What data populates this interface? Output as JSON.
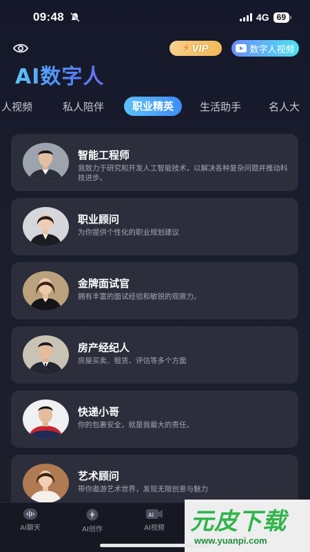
{
  "status": {
    "time": "09:48",
    "network": "4G",
    "battery": "69"
  },
  "header": {
    "vip_label": "VIP",
    "video_label": "数字人视频",
    "title": "AI数字人"
  },
  "tabs": [
    {
      "label": "人视频"
    },
    {
      "label": "私人陪伴"
    },
    {
      "label": "职业精英",
      "active": true
    },
    {
      "label": "生活助手"
    },
    {
      "label": "名人大"
    }
  ],
  "cards": [
    {
      "title": "智能工程师",
      "desc": "我致力于研究和开发人工智能技术，以解决各种复杂问题并推动科技进步。",
      "avatar": "engineer-avatar"
    },
    {
      "title": "职业顾问",
      "desc": "为你提供个性化的职业规划建议",
      "avatar": "consultant-avatar"
    },
    {
      "title": "金牌面试官",
      "desc": "拥有丰富的面试经验和敏锐的观察力。",
      "avatar": "interviewer-avatar"
    },
    {
      "title": "房产经纪人",
      "desc": "房屋买卖、租赁、评估等多个方面",
      "avatar": "realtor-avatar"
    },
    {
      "title": "快递小哥",
      "desc": "你的包裹安全，就是我最大的责任。",
      "avatar": "courier-avatar"
    },
    {
      "title": "艺术顾问",
      "desc": "带你遨游艺术世界，发现无限创意与魅力",
      "avatar": "art-advisor-avatar"
    }
  ],
  "bottom_nav": [
    {
      "label": "AI聊天",
      "icon": "wave-icon"
    },
    {
      "label": "AI创作",
      "icon": "bolt-icon"
    },
    {
      "label": "AI视频",
      "icon": "ai-video-icon"
    }
  ],
  "watermark": {
    "text": "元皮下载",
    "url": "www.yuanpi.com"
  },
  "colors": {
    "accent": "#3d8df5",
    "card_bg": "#2c2e3c",
    "vip": "#f3b957",
    "watermark": "#2fb54a"
  }
}
